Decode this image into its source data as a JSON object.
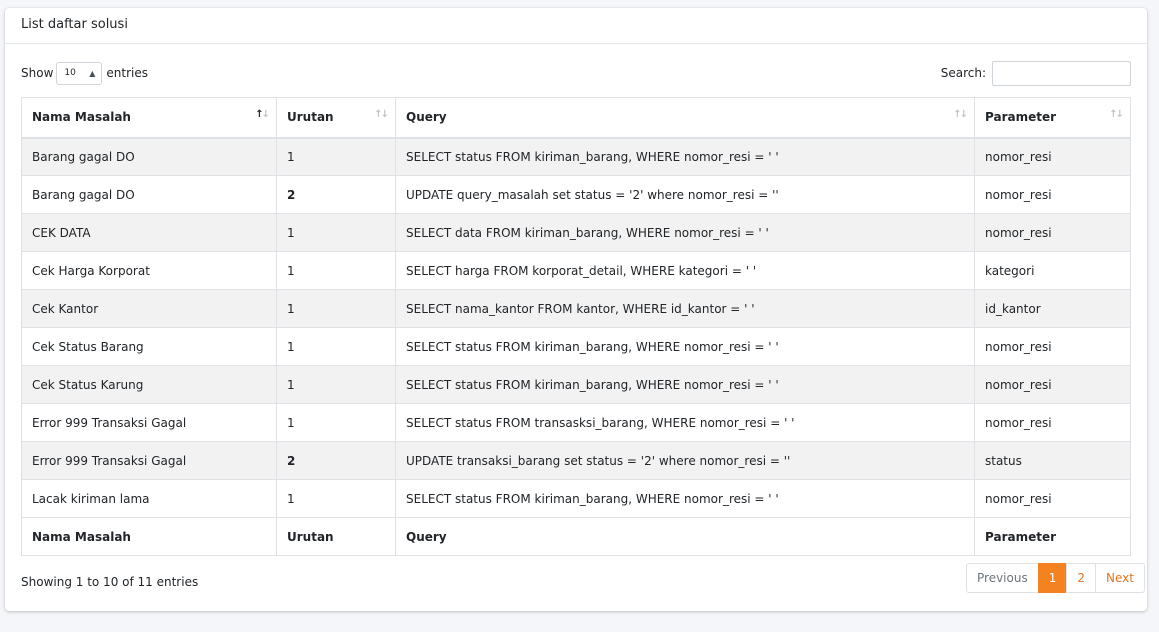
{
  "card": {
    "title": "List daftar solusi"
  },
  "length": {
    "prefix": "Show",
    "value": "10",
    "suffix": "entries"
  },
  "search": {
    "label": "Search:",
    "value": ""
  },
  "table": {
    "headers": [
      "Nama Masalah",
      "Urutan",
      "Query",
      "Parameter"
    ],
    "rows": [
      [
        "Barang gagal DO",
        "1",
        "SELECT status FROM kiriman_barang, WHERE nomor_resi = ' '",
        "nomor_resi"
      ],
      [
        "Barang gagal DO",
        "2",
        "UPDATE query_masalah set status = '2' where nomor_resi = ''",
        "nomor_resi"
      ],
      [
        "CEK DATA",
        "1",
        "SELECT data FROM kiriman_barang, WHERE nomor_resi = ' '",
        "nomor_resi"
      ],
      [
        "Cek Harga Korporat",
        "1",
        "SELECT harga FROM korporat_detail, WHERE kategori = ' '",
        "kategori"
      ],
      [
        "Cek Kantor",
        "1",
        "SELECT nama_kantor FROM kantor, WHERE id_kantor = ' '",
        "id_kantor"
      ],
      [
        "Cek Status Barang",
        "1",
        "SELECT status FROM kiriman_barang, WHERE nomor_resi = ' '",
        "nomor_resi"
      ],
      [
        "Cek Status Karung",
        "1",
        "SELECT status FROM kiriman_barang, WHERE nomor_resi = ' '",
        "nomor_resi"
      ],
      [
        "Error 999 Transaksi Gagal",
        "1",
        "SELECT status FROM transasksi_barang, WHERE nomor_resi = ' '",
        "nomor_resi"
      ],
      [
        "Error 999 Transaksi Gagal",
        "2",
        "UPDATE transaksi_barang set status = '2' where nomor_resi = ''",
        "status"
      ],
      [
        "Lacak kiriman lama",
        "1",
        "SELECT status FROM kiriman_barang, WHERE nomor_resi = ' '",
        "nomor_resi"
      ]
    ],
    "bold_urutan": [
      "2"
    ]
  },
  "info": "Showing 1 to 10 of 11 entries",
  "pagination": {
    "previous": "Previous",
    "pages": [
      "1",
      "2"
    ],
    "next": "Next",
    "active": "1"
  },
  "colors": {
    "accent": "#f58220",
    "link": "#e8741e",
    "stripe": "#f2f2f2"
  }
}
